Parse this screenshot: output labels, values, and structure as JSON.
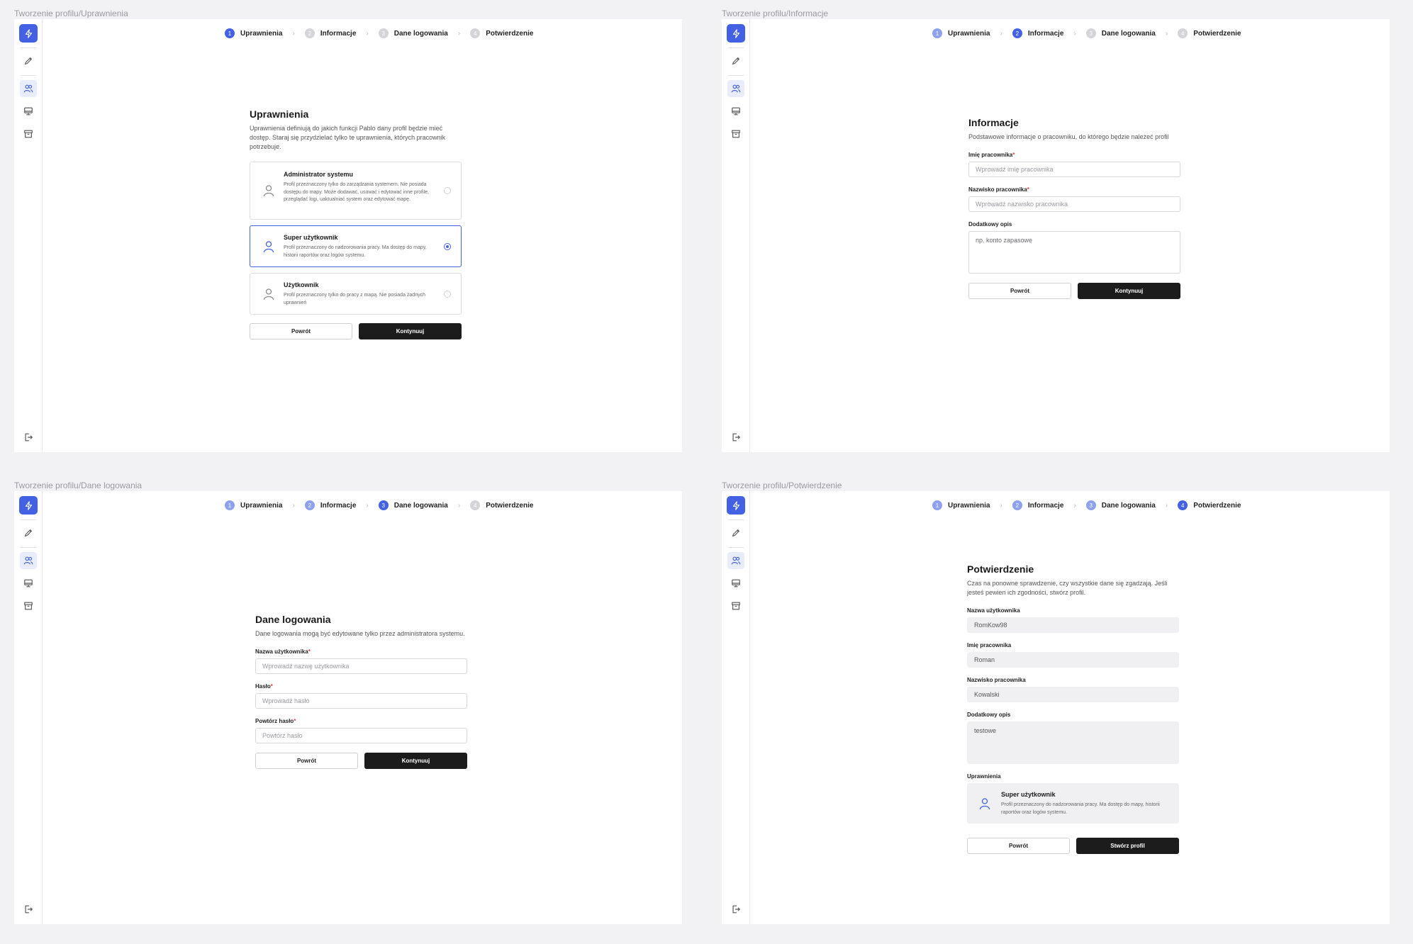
{
  "labels": {
    "uprawnienia": "Tworzenie profilu/Uprawnienia",
    "informacje": "Tworzenie profilu/Informacje",
    "dane": "Tworzenie profilu/Dane logowania",
    "potwierdzenie": "Tworzenie profilu/Potwierdzenie"
  },
  "steps": {
    "s1": {
      "num": "1",
      "label": "Uprawnienia"
    },
    "s2": {
      "num": "2",
      "label": "Informacje"
    },
    "s3": {
      "num": "3",
      "label": "Dane logowania"
    },
    "s4": {
      "num": "4",
      "label": "Potwierdzenie"
    },
    "chevron": "›"
  },
  "sidebar": {
    "logo_icon": "bolt-icon",
    "icons": [
      "pencil-icon",
      "users-icon",
      "monitor-icon",
      "archive-icon",
      "logout-icon"
    ],
    "accent": "#4461e3"
  },
  "common": {
    "back": "Powrót",
    "continue": "Kontynuuj",
    "create": "Stwórz profil"
  },
  "uprawnienia": {
    "title": "Uprawnienia",
    "desc": "Uprawnienia definiują do jakich funkcji Pablo dany profil będzie mieć dostęp. Staraj się przydzielać tylko te uprawnienia, których pracownik potrzebuje.",
    "options": [
      {
        "title": "Administrator systemu",
        "desc": "Profil przeznaczony tylko do zarządzania systemem. Nie posiada dostępu do mapy. Może dodawać, usuwać i edytować inne profile, przeglądać logi, uaktualniać system oraz edytować mapę.",
        "selected": false
      },
      {
        "title": "Super użytkownik",
        "desc": "Profil przeznaczony do nadzorowania pracy. Ma dostęp do mapy, historii raportów oraz logów systemu.",
        "selected": true
      },
      {
        "title": "Użytkownik",
        "desc": "Profil przeznaczony tylko do pracy z mapą. Nie posiada żadnych uprawnień",
        "selected": false
      }
    ]
  },
  "informacje": {
    "title": "Informacje",
    "desc": "Podstawowe informacje o pracowniku, do którego będzie należeć profil",
    "first_name_label": "Imię pracownika",
    "first_name_placeholder": "Wprowadź imię pracownika",
    "last_name_label": "Nazwisko pracownika",
    "last_name_placeholder": "Wprowadź nazwisko pracownika",
    "extra_label": "Dodatkowy opis",
    "extra_placeholder": "np. konto zapasowe",
    "required_mark": "*"
  },
  "dane": {
    "title": "Dane logowania",
    "desc": "Dane logowania mogą być edytowane tylko przez administratora systemu.",
    "username_label": "Nazwa użytkownika",
    "username_placeholder": "Wprowadź nazwę użytkownika",
    "password_label": "Hasło",
    "password_placeholder": "Wprowadź hasło",
    "repeat_label": "Powtórz hasło",
    "repeat_placeholder": "Powtórz hasło",
    "required_mark": "*"
  },
  "potwierdzenie": {
    "title": "Potwierdzenie",
    "desc": "Czas na ponowne sprawdzenie, czy wszystkie dane się zgadzają. Jeśli jesteś pewien ich zgodności, stwórz profil.",
    "username_label": "Nazwa użytkownika",
    "username_value": "RomKow98",
    "first_name_label": "Imię pracownika",
    "first_name_value": "Roman",
    "last_name_label": "Nazwisko pracownika",
    "last_name_value": "Kowalski",
    "extra_label": "Dodatkowy opis",
    "extra_value": "testowe",
    "perm_label": "Uprawnienia",
    "perm_title": "Super użytkownik",
    "perm_desc": "Profil przeznaczony do nadzorowania pracy. Ma dostęp do mapy, historii raportów oraz logów systemu."
  }
}
